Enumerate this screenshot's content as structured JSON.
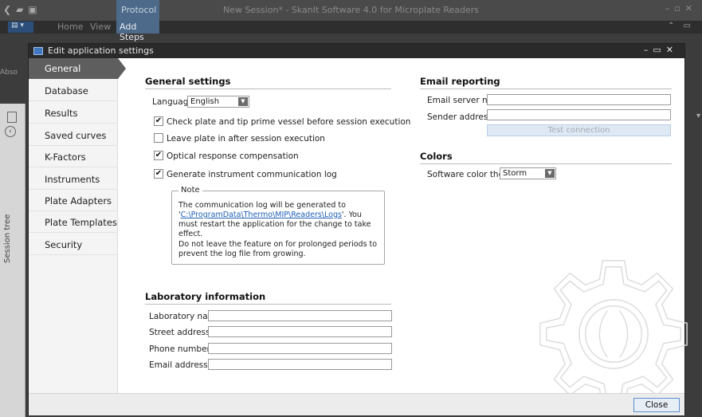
{
  "app": {
    "title": "New Session* - SkanIt Software 4.0 for Microplate Readers",
    "context_tab": "Protocol",
    "ribbon_tabs": [
      "Home",
      "View"
    ],
    "active_ribbon_tab": "Add Steps",
    "left_text": "Abso",
    "session_tree_label": "Session tree"
  },
  "dialog": {
    "title": "Edit application settings",
    "sidebar": [
      {
        "label": "General",
        "active": true
      },
      {
        "label": "Database"
      },
      {
        "label": "Results"
      },
      {
        "label": "Saved curves"
      },
      {
        "label": "K-Factors"
      },
      {
        "label": "Instruments"
      },
      {
        "label": "Plate Adapters"
      },
      {
        "label": "Plate Templates"
      },
      {
        "label": "Security"
      }
    ],
    "general": {
      "heading": "General settings",
      "language_label": "Language:",
      "language_value": "English",
      "checkboxes": [
        {
          "label": "Check plate and tip prime vessel before session execution",
          "checked": true
        },
        {
          "label": "Leave plate in after session execution",
          "checked": false
        },
        {
          "label": "Optical response compensation",
          "checked": true
        },
        {
          "label": "Generate instrument communication log",
          "checked": true
        }
      ],
      "note": {
        "legend": "Note",
        "line1_pre": "The communication log will be generated to '",
        "path": "C:\\ProgramData\\Thermo\\MIP\\Readers\\Logs",
        "line1_post": "'. You must restart the application for the change to take effect.",
        "line2": "Do not leave the feature on for prolonged periods to prevent the log file from growing."
      }
    },
    "lab": {
      "heading": "Laboratory information",
      "fields": [
        {
          "label": "Laboratory name:",
          "value": ""
        },
        {
          "label": "Street address:",
          "value": ""
        },
        {
          "label": "Phone number:",
          "value": ""
        },
        {
          "label": "Email address:",
          "value": ""
        }
      ]
    },
    "email": {
      "heading": "Email reporting",
      "server_label": "Email server name:",
      "server_value": "",
      "sender_label": "Sender address:",
      "sender_value": "",
      "test_label": "Test connection"
    },
    "colors": {
      "heading": "Colors",
      "theme_label": "Software color theme:",
      "theme_value": "Storm"
    },
    "close_label": "Close"
  }
}
